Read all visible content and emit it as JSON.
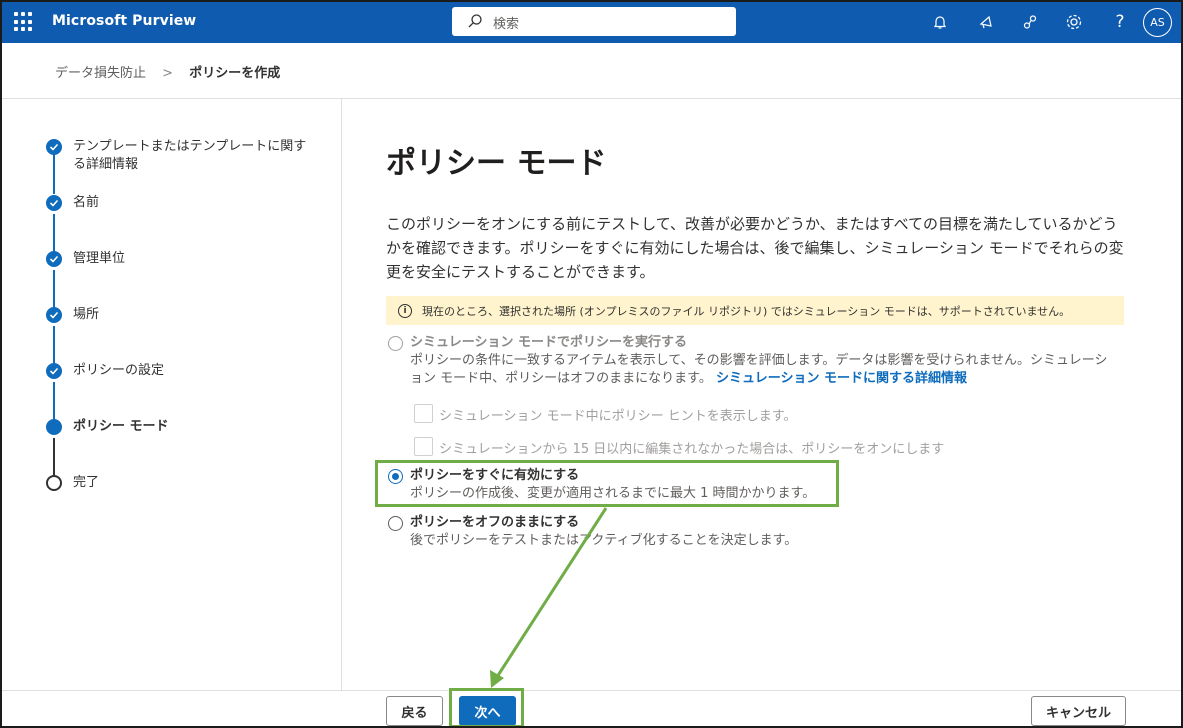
{
  "header": {
    "app_title": "Microsoft Purview",
    "search_placeholder": "検索",
    "avatar_initials": "AS"
  },
  "breadcrumb": {
    "parent": "データ損失防止",
    "separator": ">",
    "current": "ポリシーを作成"
  },
  "steps": [
    {
      "label": "テンプレートまたはテンプレートに関する詳細情報",
      "state": "done"
    },
    {
      "label": "名前",
      "state": "done"
    },
    {
      "label": "管理単位",
      "state": "done"
    },
    {
      "label": "場所",
      "state": "done"
    },
    {
      "label": "ポリシーの設定",
      "state": "done"
    },
    {
      "label": "ポリシー モード",
      "state": "current"
    },
    {
      "label": "完了",
      "state": "pending"
    }
  ],
  "main": {
    "title": "ポリシー モード",
    "description": "このポリシーをオンにする前にテストして、改善が必要かどうか、またはすべての目標を満たしているかどうかを確認できます。ポリシーをすぐに有効にした場合は、後で編集し、シミュレーション モードでそれらの変更を安全にテストすることができます。",
    "info_message": "現在のところ、選択された場所 (オンプレミスのファイル リポジトリ) ではシミュレーション モードは、サポートされていません。",
    "options": {
      "simulation": {
        "title": "シミュレーション モードでポリシーを実行する",
        "desc_line1": "ポリシーの条件に一致するアイテムを表示して、その影響を評価します。データは影響を受けられません。シミュレーシ",
        "desc_line2": "ョン モード中、ポリシーはオフのままになります。",
        "link": "シミュレーション モードに関する詳細情報",
        "checkbox1": "シミュレーション モード中にポリシー ヒントを表示します。",
        "checkbox2": "シミュレーションから 15 日以内に編集されなかった場合は、ポリシーをオンにします"
      },
      "immediate": {
        "title": "ポリシーをすぐに有効にする",
        "desc": "ポリシーの作成後、変更が適用されるまでに最大 1 時間かかります。",
        "selected": true
      },
      "off": {
        "title": "ポリシーをオフのままにする",
        "desc": "後でポリシーをテストまたはアクティブ化することを決定します。"
      }
    }
  },
  "footer": {
    "back_label": "戻る",
    "next_label": "次へ",
    "cancel_label": "キャンセル"
  },
  "colors": {
    "header_bg": "#0f5bb0",
    "accent": "#0f6cbd",
    "highlight": "#70ad47",
    "info_bg": "#fff4ce"
  }
}
